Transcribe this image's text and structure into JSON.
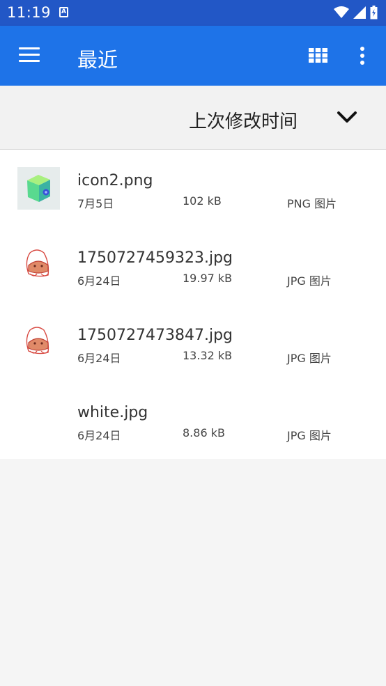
{
  "status_bar": {
    "time": "11:19",
    "notification_icon": "a-icon",
    "icons": [
      "wifi-icon",
      "signal-icon",
      "battery-icon"
    ]
  },
  "app_bar": {
    "title": "最近",
    "background": "#1e73e8"
  },
  "sort": {
    "label": "上次修改时间"
  },
  "files": [
    {
      "name": "icon2.png",
      "date": "7月5日",
      "size": "102 kB",
      "type": "PNG 图片",
      "thumb": "green-cube"
    },
    {
      "name": "1750727459323.jpg",
      "date": "6月24日",
      "size": "19.97 kB",
      "type": "JPG 图片",
      "thumb": "sketch"
    },
    {
      "name": "1750727473847.jpg",
      "date": "6月24日",
      "size": "13.32 kB",
      "type": "JPG 图片",
      "thumb": "sketch"
    },
    {
      "name": "white.jpg",
      "date": "6月24日",
      "size": "8.86 kB",
      "type": "JPG 图片",
      "thumb": "white"
    }
  ]
}
